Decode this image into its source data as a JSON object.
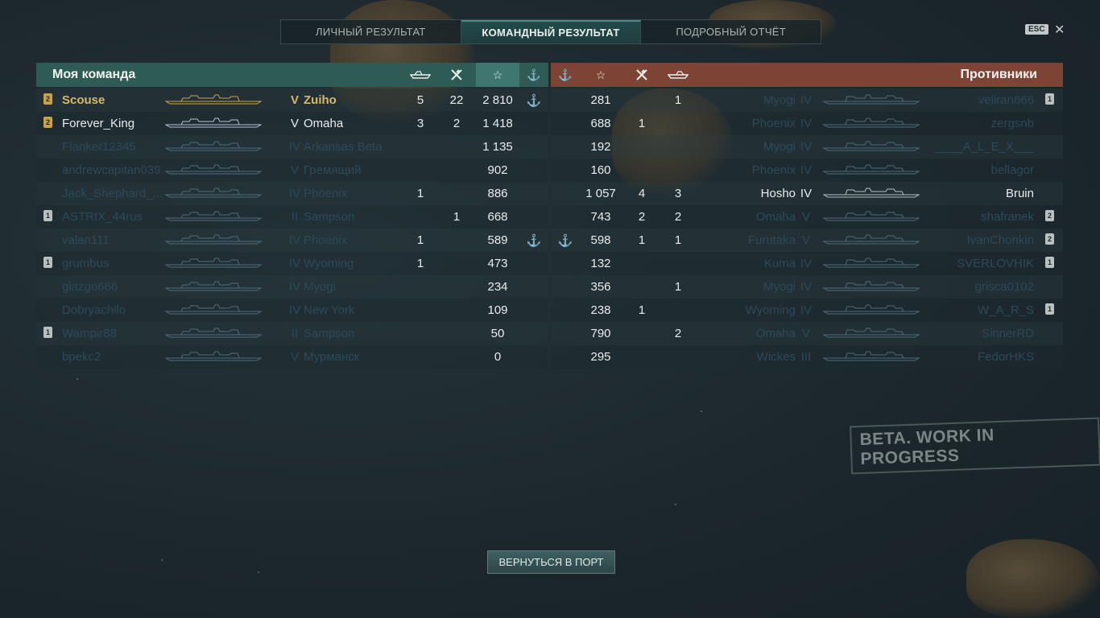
{
  "tabs": [
    {
      "label": "ЛИЧНЫЙ РЕЗУЛЬТАТ",
      "active": false
    },
    {
      "label": "КОМАНДНЫЙ РЕЗУЛЬТАТ",
      "active": true
    },
    {
      "label": "ПОДРОБНЫЙ ОТЧЁТ",
      "active": false
    }
  ],
  "esc_label": "ESC",
  "close_glyph": "✕",
  "left_team": {
    "title": "Моя команда",
    "header_icons": [
      "ship-sunk-icon",
      "planes-destroyed-icon",
      "experience-star-icon",
      "capture-anchor-icon"
    ],
    "rows": [
      {
        "badge": "2",
        "badge_style": "gold",
        "name": "Scouse",
        "tier": "V",
        "ship": "Zuiho",
        "c1": "5",
        "c2": "22",
        "xp": "2 810",
        "anchor": "⚓",
        "style": "highlight"
      },
      {
        "badge": "2",
        "badge_style": "gold",
        "name": "Forever_King",
        "tier": "V",
        "ship": "Omaha",
        "c1": "3",
        "c2": "2",
        "xp": "1 418",
        "anchor": "",
        "style": "white"
      },
      {
        "badge": "",
        "badge_style": "",
        "name": "Flanker12345",
        "tier": "IV",
        "ship": "Arkansas Beta",
        "c1": "",
        "c2": "",
        "xp": "1 135",
        "anchor": "",
        "style": "dim"
      },
      {
        "badge": "",
        "badge_style": "",
        "name": "andrewcapitan039",
        "tier": "V",
        "ship": "Гремящий",
        "c1": "",
        "c2": "",
        "xp": "902",
        "anchor": "",
        "style": "dim"
      },
      {
        "badge": "",
        "badge_style": "",
        "name": "Jack_Shephard_...",
        "tier": "IV",
        "ship": "Phoenix",
        "c1": "1",
        "c2": "",
        "xp": "886",
        "anchor": "",
        "style": "dim"
      },
      {
        "badge": "1",
        "badge_style": "gray",
        "name": "ASTRIX_44rus",
        "tier": "II",
        "ship": "Sampson",
        "c1": "",
        "c2": "1",
        "xp": "668",
        "anchor": "",
        "style": "dim"
      },
      {
        "badge": "",
        "badge_style": "",
        "name": "valan111",
        "tier": "IV",
        "ship": "Phoenix",
        "c1": "1",
        "c2": "",
        "xp": "589",
        "anchor": "⚓",
        "style": "dim"
      },
      {
        "badge": "1",
        "badge_style": "gray",
        "name": "grumbus",
        "tier": "IV",
        "ship": "Wyoming",
        "c1": "1",
        "c2": "",
        "xp": "473",
        "anchor": "",
        "style": "dim"
      },
      {
        "badge": "",
        "badge_style": "",
        "name": "glazgo666",
        "tier": "IV",
        "ship": "Myogi",
        "c1": "",
        "c2": "",
        "xp": "234",
        "anchor": "",
        "style": "dim"
      },
      {
        "badge": "",
        "badge_style": "",
        "name": "Dobryachilo",
        "tier": "IV",
        "ship": "New York",
        "c1": "",
        "c2": "",
        "xp": "109",
        "anchor": "",
        "style": "dim"
      },
      {
        "badge": "1",
        "badge_style": "gray",
        "name": "Wampir88",
        "tier": "II",
        "ship": "Sampson",
        "c1": "",
        "c2": "",
        "xp": "50",
        "anchor": "",
        "style": "dim"
      },
      {
        "badge": "",
        "badge_style": "",
        "name": "bpekc2",
        "tier": "V",
        "ship": "Мурманск",
        "c1": "",
        "c2": "",
        "xp": "0",
        "anchor": "",
        "style": "dim"
      }
    ]
  },
  "right_team": {
    "title": "Противники",
    "header_icons": [
      "capture-anchor-icon",
      "experience-star-icon",
      "planes-destroyed-icon",
      "ship-sunk-icon"
    ],
    "rows": [
      {
        "anchor": "",
        "xp": "281",
        "c2": "",
        "c1": "1",
        "ship": "Myogi",
        "tier": "IV",
        "name": "veliran666",
        "badge": "1",
        "style": "dim"
      },
      {
        "anchor": "",
        "xp": "688",
        "c2": "1",
        "c1": "",
        "ship": "Phoenix",
        "tier": "IV",
        "name": "zergsnb",
        "badge": "",
        "style": "dim"
      },
      {
        "anchor": "",
        "xp": "192",
        "c2": "",
        "c1": "",
        "ship": "Myogi",
        "tier": "IV",
        "name": "____A_L_E_X___",
        "badge": "",
        "style": "dim"
      },
      {
        "anchor": "",
        "xp": "160",
        "c2": "",
        "c1": "",
        "ship": "Phoenix",
        "tier": "IV",
        "name": "bellagor",
        "badge": "",
        "style": "dim"
      },
      {
        "anchor": "",
        "xp": "1 057",
        "c2": "4",
        "c1": "3",
        "ship": "Hosho",
        "tier": "IV",
        "name": "Bruin",
        "badge": "",
        "style": "white"
      },
      {
        "anchor": "",
        "xp": "743",
        "c2": "2",
        "c1": "2",
        "ship": "Omaha",
        "tier": "V",
        "name": "shafranek",
        "badge": "2",
        "style": "dim"
      },
      {
        "anchor": "⚓",
        "xp": "598",
        "c2": "1",
        "c1": "1",
        "ship": "Furutaka",
        "tier": "V",
        "name": "IvanChonkin",
        "badge": "2",
        "style": "dim"
      },
      {
        "anchor": "",
        "xp": "132",
        "c2": "",
        "c1": "",
        "ship": "Kuma",
        "tier": "IV",
        "name": "SVERLOVHIK",
        "badge": "1",
        "style": "dim"
      },
      {
        "anchor": "",
        "xp": "356",
        "c2": "",
        "c1": "1",
        "ship": "Myogi",
        "tier": "IV",
        "name": "grisca0102",
        "badge": "",
        "style": "dim"
      },
      {
        "anchor": "",
        "xp": "238",
        "c2": "1",
        "c1": "",
        "ship": "Wyoming",
        "tier": "IV",
        "name": "W_A_R_S",
        "badge": "1",
        "style": "dim"
      },
      {
        "anchor": "",
        "xp": "790",
        "c2": "",
        "c1": "2",
        "ship": "Omaha",
        "tier": "V",
        "name": "SinnerRD",
        "badge": "",
        "style": "dim"
      },
      {
        "anchor": "",
        "xp": "295",
        "c2": "",
        "c1": "",
        "ship": "Wickes",
        "tier": "III",
        "name": "FedorHKS",
        "badge": "",
        "style": "dim"
      }
    ]
  },
  "beta_stamp": "BETA. WORK IN PROGRESS",
  "return_button": "ВЕРНУТЬСЯ В ПОРТ",
  "colors": {
    "team_header": "#2e5c55",
    "enemy_header": "#7d4436",
    "highlight": "#d7b86a"
  }
}
